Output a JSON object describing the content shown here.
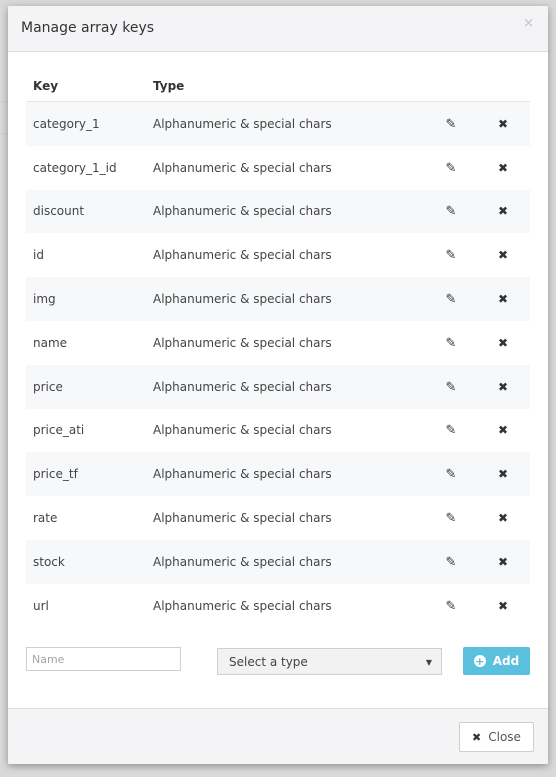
{
  "modal": {
    "title": "Manage array keys",
    "close_glyph": "×"
  },
  "table": {
    "headers": {
      "key": "Key",
      "type": "Type"
    },
    "rows": [
      {
        "key": "category_1",
        "type": "Alphanumeric & special chars"
      },
      {
        "key": "category_1_id",
        "type": "Alphanumeric & special chars"
      },
      {
        "key": "discount",
        "type": "Alphanumeric & special chars"
      },
      {
        "key": "id",
        "type": "Alphanumeric & special chars"
      },
      {
        "key": "img",
        "type": "Alphanumeric & special chars"
      },
      {
        "key": "name",
        "type": "Alphanumeric & special chars"
      },
      {
        "key": "price",
        "type": "Alphanumeric & special chars"
      },
      {
        "key": "price_ati",
        "type": "Alphanumeric & special chars"
      },
      {
        "key": "price_tf",
        "type": "Alphanumeric & special chars"
      },
      {
        "key": "rate",
        "type": "Alphanumeric & special chars"
      },
      {
        "key": "stock",
        "type": "Alphanumeric & special chars"
      },
      {
        "key": "url",
        "type": "Alphanumeric & special chars"
      }
    ],
    "edit_icon": "pencil-icon",
    "delete_icon": "times-icon"
  },
  "form": {
    "name_placeholder": "Name",
    "type_select": "Select a type",
    "add_label": "Add"
  },
  "footer": {
    "close_label": "Close"
  },
  "colors": {
    "accent": "#5bc0de",
    "header_bg": "#f4f4f6",
    "row_alt": "#f7f8fa"
  }
}
